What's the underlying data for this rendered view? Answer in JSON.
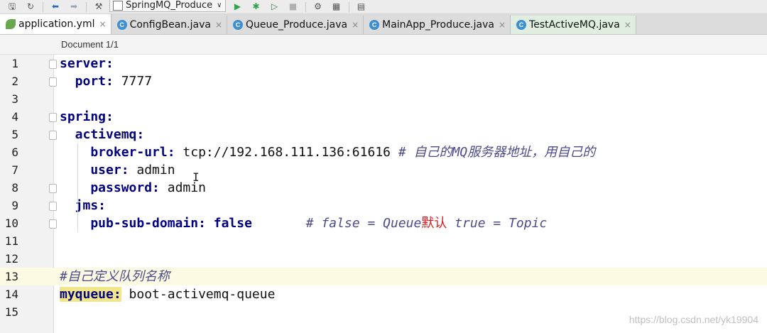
{
  "toolbar": {
    "run_config": "SpringMQ_Produce",
    "icons": [
      "save-icon",
      "sync-icon",
      "back-arrow-icon",
      "forward-arrow-icon",
      "build-icon",
      "run-icon",
      "debug-icon",
      "coverage-icon",
      "stop-icon",
      "project-structure-icon",
      "sdk-icon",
      "tasks-icon"
    ]
  },
  "tabs": [
    {
      "label": "application.yml",
      "icon": "yaml-leaf-icon",
      "active": true
    },
    {
      "label": "ConfigBean.java",
      "icon": "class-icon"
    },
    {
      "label": "Queue_Produce.java",
      "icon": "class-icon"
    },
    {
      "label": "MainApp_Produce.java",
      "icon": "class-icon"
    },
    {
      "label": "TestActiveMQ.java",
      "icon": "class-icon"
    }
  ],
  "tab_close_glyph": "×",
  "breadcrumb": "Document 1/1",
  "lines": [
    {
      "n": "1",
      "parts": [
        {
          "t": "server:",
          "c": "k"
        }
      ]
    },
    {
      "n": "2",
      "parts": [
        {
          "t": "  port:",
          "c": "k"
        },
        {
          "t": " 7777",
          "c": "v"
        }
      ]
    },
    {
      "n": "3",
      "parts": []
    },
    {
      "n": "4",
      "parts": [
        {
          "t": "spring:",
          "c": "k"
        }
      ]
    },
    {
      "n": "5",
      "parts": [
        {
          "t": "  activemq:",
          "c": "k"
        }
      ]
    },
    {
      "n": "6",
      "parts": [
        {
          "t": "    broker-url:",
          "c": "k"
        },
        {
          "t": " tcp://192.168.111.136:61616 ",
          "c": "v"
        },
        {
          "t": "# 自己的MQ服务器地址，用自己的",
          "c": "cm"
        }
      ]
    },
    {
      "n": "7",
      "parts": [
        {
          "t": "    user:",
          "c": "k"
        },
        {
          "t": " admin",
          "c": "v"
        }
      ]
    },
    {
      "n": "8",
      "parts": [
        {
          "t": "    password:",
          "c": "k"
        },
        {
          "t": " admin",
          "c": "v"
        }
      ]
    },
    {
      "n": "9",
      "parts": [
        {
          "t": "  jms:",
          "c": "k"
        }
      ]
    },
    {
      "n": "10",
      "parts": [
        {
          "t": "    pub-sub-domain:",
          "c": "k"
        },
        {
          "t": " false",
          "c": "k"
        },
        {
          "t": "       ",
          "c": "v"
        },
        {
          "t": "# false = Queue",
          "c": "cm"
        },
        {
          "t": "默认",
          "c": "red"
        },
        {
          "t": " true = Topic",
          "c": "cm"
        }
      ]
    },
    {
      "n": "11",
      "parts": []
    },
    {
      "n": "12",
      "parts": []
    },
    {
      "n": "13",
      "parts": [
        {
          "t": "#自己定义队列名称",
          "c": "cm"
        }
      ]
    },
    {
      "n": "14",
      "parts": [
        {
          "t": "myqueue:",
          "c": "k hl"
        },
        {
          "t": " boot-activemq-queue",
          "c": "v"
        }
      ]
    },
    {
      "n": "15",
      "parts": []
    }
  ],
  "current_line": "13",
  "caret_glyph": "I",
  "watermark": "https://blog.csdn.net/yk19904"
}
